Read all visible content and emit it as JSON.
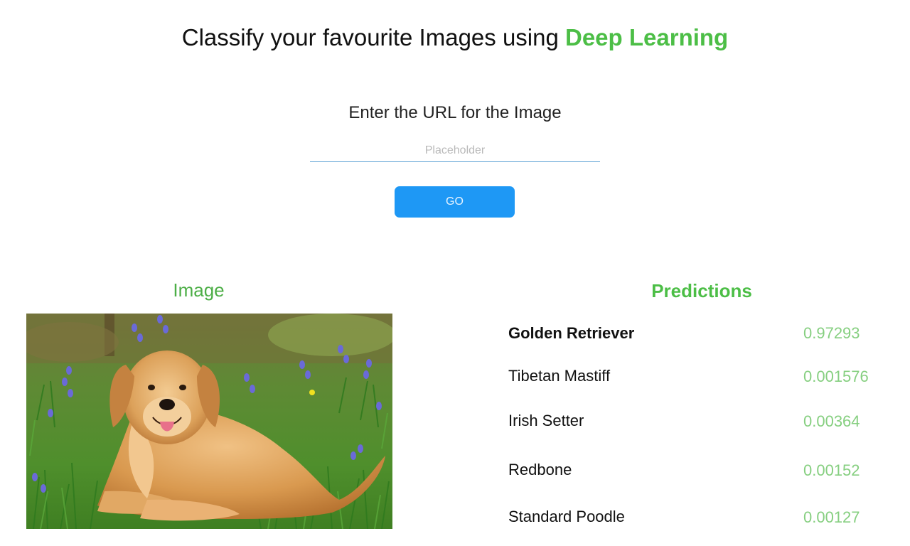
{
  "header": {
    "title_prefix": "Classify your favourite Images using ",
    "title_accent": "Deep Learning"
  },
  "form": {
    "url_label": "Enter the URL for the Image",
    "url_value": "",
    "url_placeholder": "Placeholder",
    "go_label": "GO"
  },
  "image_panel": {
    "heading": "Image",
    "subject": "golden retriever lying in grass with bluebells"
  },
  "predictions": {
    "heading": "Predictions",
    "items": [
      {
        "label": "Golden Retriever",
        "score": "0.97293"
      },
      {
        "label": "Tibetan Mastiff",
        "score": "0.001576"
      },
      {
        "label": "Irish Setter",
        "score": "0.00364"
      },
      {
        "label": "Redbone",
        "score": "0.00152"
      },
      {
        "label": "Standard Poodle",
        "score": "0.00127"
      }
    ]
  },
  "colors": {
    "accent_green": "#4cbe46",
    "score_green": "#86cf80",
    "button_blue": "#1e98f5",
    "input_underline": "#6aa9d8"
  }
}
